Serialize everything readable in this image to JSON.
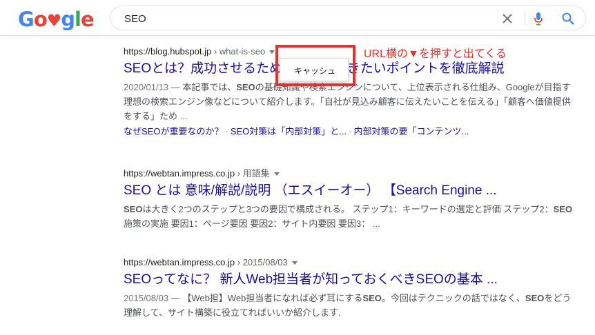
{
  "search": {
    "logo_text": "Google",
    "query": "SEO"
  },
  "results": [
    {
      "site": "https://blog.hubspot.jp",
      "path": "› what-is-seo",
      "title": "SEOとは？成功させるために知っておきたいポイントを徹底解説",
      "date": "2020/01/13",
      "snippet_html": "本記事では、<b>SEO</b>の基礎知識や検索エンジンについて、上位表示される仕組み、Googleが目指す理想の検索エンジン像などについて紹介します。「自社が見込み顧客に伝えたいことを伝える」「顧客へ価値提供をする」ため ...",
      "sitelinks": [
        "なぜSEOが重要なのか？",
        "SEO対策は「内部対策」と...",
        "内部対策の要「コンテンツ..."
      ]
    },
    {
      "site": "https://webtan.impress.co.jp",
      "path": "› 用語集",
      "title": "SEO とは 意味/解説/説明 （エスイーオー） 【Search Engine ...",
      "date": "",
      "snippet_html": "<b>SEO</b>は大きく2つのステップと3つの要因で構成される。 ステップ1：キーワードの選定と評価 ステップ2：<b>SEO</b>施策の実施 要因1：ページ要因 要因2：サイト内要因 要因3： ...",
      "sitelinks": []
    },
    {
      "site": "https://webtan.impress.co.jp",
      "path": "› 2015/08/03",
      "title": "SEOってなに？ 新人Web担当者が知っておくべきSEOの基本 ...",
      "date": "2015/08/03",
      "snippet_html": "【Web担】Web担当者になれば必ず耳にする<b>SEO</b>。今回はテクニックの話ではなく、<b>SEO</b>をどう理解して、サイト構築に役立てればいいか紹介します.",
      "sitelinks": []
    }
  ],
  "popup": {
    "cache_label": "キャッシュ"
  },
  "annotation": {
    "text": "URL横の▼を押すと出てくる",
    "color": "#e8302b"
  }
}
